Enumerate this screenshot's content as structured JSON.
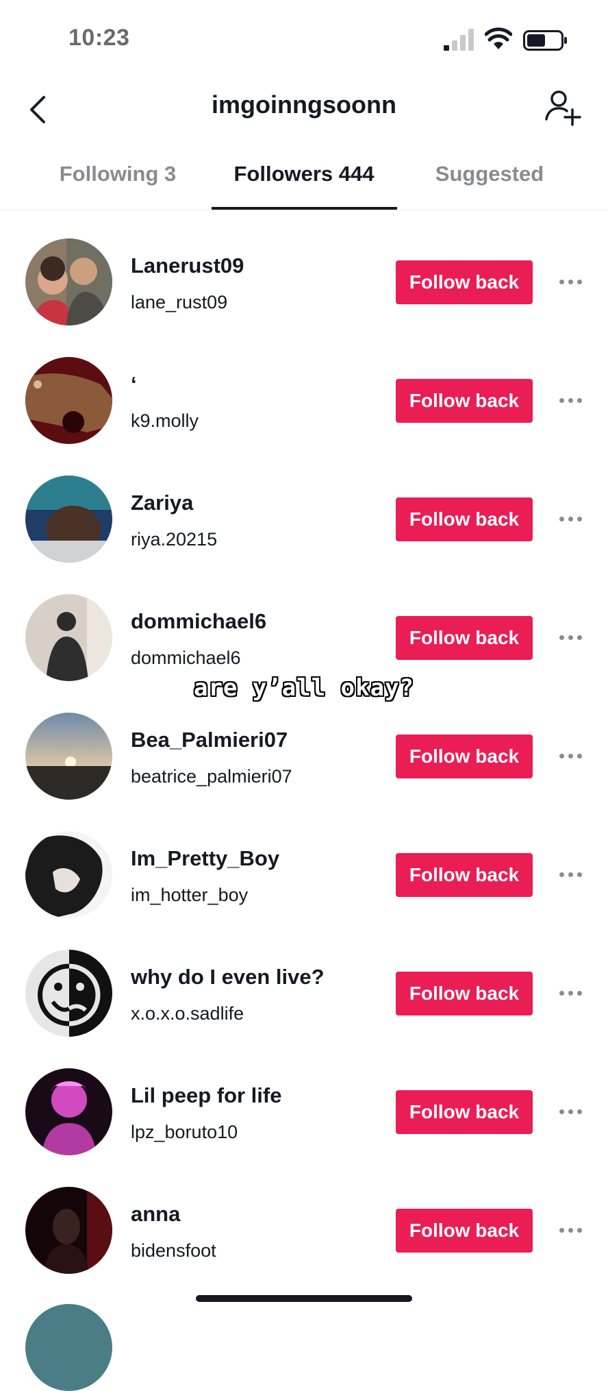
{
  "status_bar": {
    "time": "10:23"
  },
  "header": {
    "title": "imgoinngsoonn"
  },
  "tabs": [
    {
      "label": "Following 3",
      "active": false
    },
    {
      "label": "Followers 444",
      "active": true
    },
    {
      "label": "Suggested",
      "active": false
    }
  ],
  "followers": [
    {
      "name": "Lanerust09",
      "handle": "lane_rust09",
      "button": "Follow back"
    },
    {
      "name": "‘",
      "handle": "k9.molly",
      "button": "Follow back"
    },
    {
      "name": "Zariya",
      "handle": "riya.20215",
      "button": "Follow back"
    },
    {
      "name": "dommichael6",
      "handle": "dommichael6",
      "button": "Follow back"
    },
    {
      "name": "Bea_Palmieri07",
      "handle": "beatrice_palmieri07",
      "button": "Follow back"
    },
    {
      "name": "Im_Pretty_Boy",
      "handle": "im_hotter_boy",
      "button": "Follow back"
    },
    {
      "name": "why do I even live?",
      "handle": "x.o.x.o.sadlife",
      "button": "Follow back"
    },
    {
      "name": "Lil peep for life",
      "handle": "lpz_boruto10",
      "button": "Follow back"
    },
    {
      "name": "anna",
      "handle": "bidensfoot",
      "button": "Follow back"
    }
  ],
  "overlay_caption": "are y’all okay?",
  "colors": {
    "follow_button": "#ea1d54",
    "text_primary": "#161823",
    "text_secondary": "#8a8b91"
  }
}
